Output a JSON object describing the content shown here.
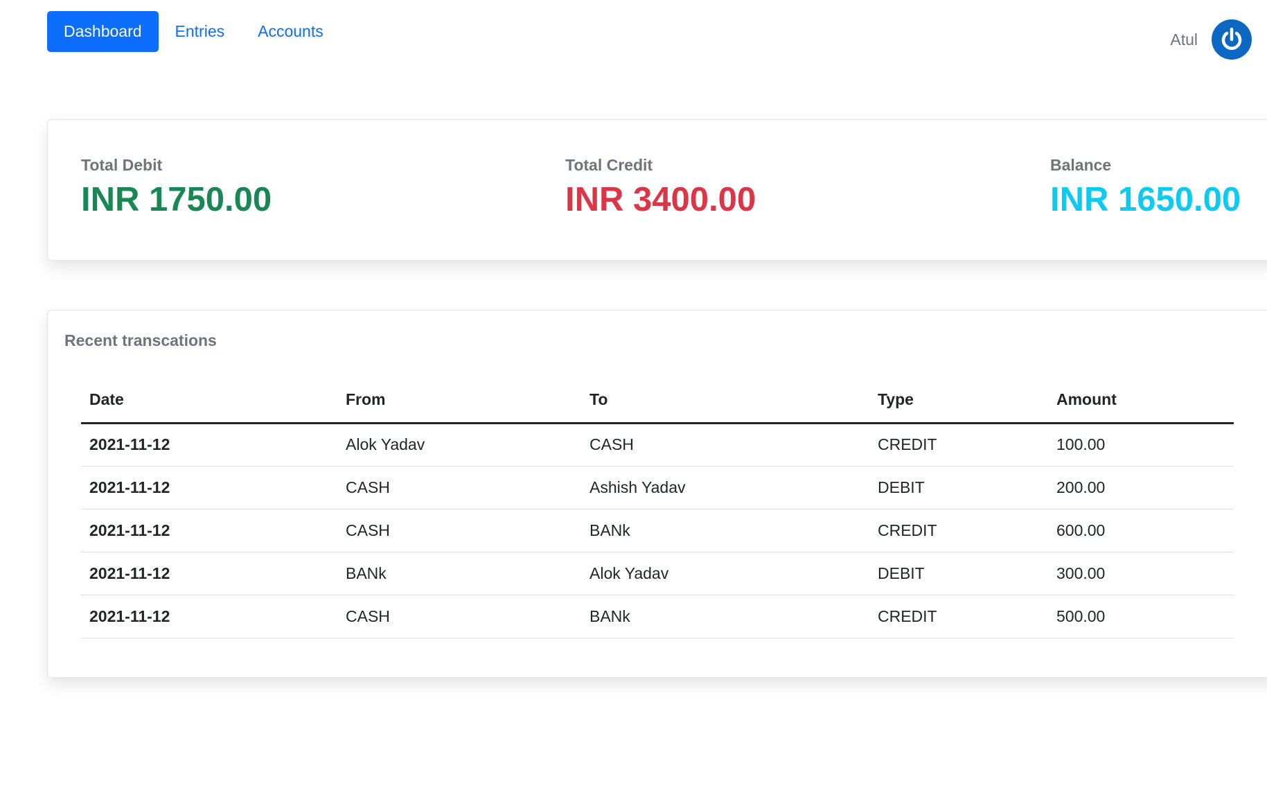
{
  "nav": {
    "items": [
      {
        "label": "Dashboard",
        "active": true
      },
      {
        "label": "Entries",
        "active": false
      },
      {
        "label": "Accounts",
        "active": false
      }
    ]
  },
  "user": {
    "name": "Atul",
    "logout_icon": "power-icon"
  },
  "summary": {
    "total_debit": {
      "label": "Total Debit",
      "value": "INR 1750.00",
      "color": "#198754"
    },
    "total_credit": {
      "label": "Total Credit",
      "value": "INR 3400.00",
      "color": "#dc3545"
    },
    "balance": {
      "label": "Balance",
      "value": "INR 1650.00",
      "color": "#0dcaf0"
    }
  },
  "transactions": {
    "title": "Recent transcations",
    "columns": [
      "Date",
      "From",
      "To",
      "Type",
      "Amount"
    ],
    "rows": [
      {
        "date": "2021-11-12",
        "from": "Alok Yadav",
        "to": "CASH",
        "type": "CREDIT",
        "amount": "100.00"
      },
      {
        "date": "2021-11-12",
        "from": "CASH",
        "to": "Ashish Yadav",
        "type": "DEBIT",
        "amount": "200.00"
      },
      {
        "date": "2021-11-12",
        "from": "CASH",
        "to": "BANk",
        "type": "CREDIT",
        "amount": "600.00"
      },
      {
        "date": "2021-11-12",
        "from": "BANk",
        "to": "Alok Yadav",
        "type": "DEBIT",
        "amount": "300.00"
      },
      {
        "date": "2021-11-12",
        "from": "CASH",
        "to": "BANk",
        "type": "CREDIT",
        "amount": "500.00"
      }
    ]
  },
  "colors": {
    "primary": "#0d6efd",
    "credit": "#198754",
    "debit": "#dc3545",
    "info": "#0dcaf0",
    "muted": "#6c757d"
  }
}
